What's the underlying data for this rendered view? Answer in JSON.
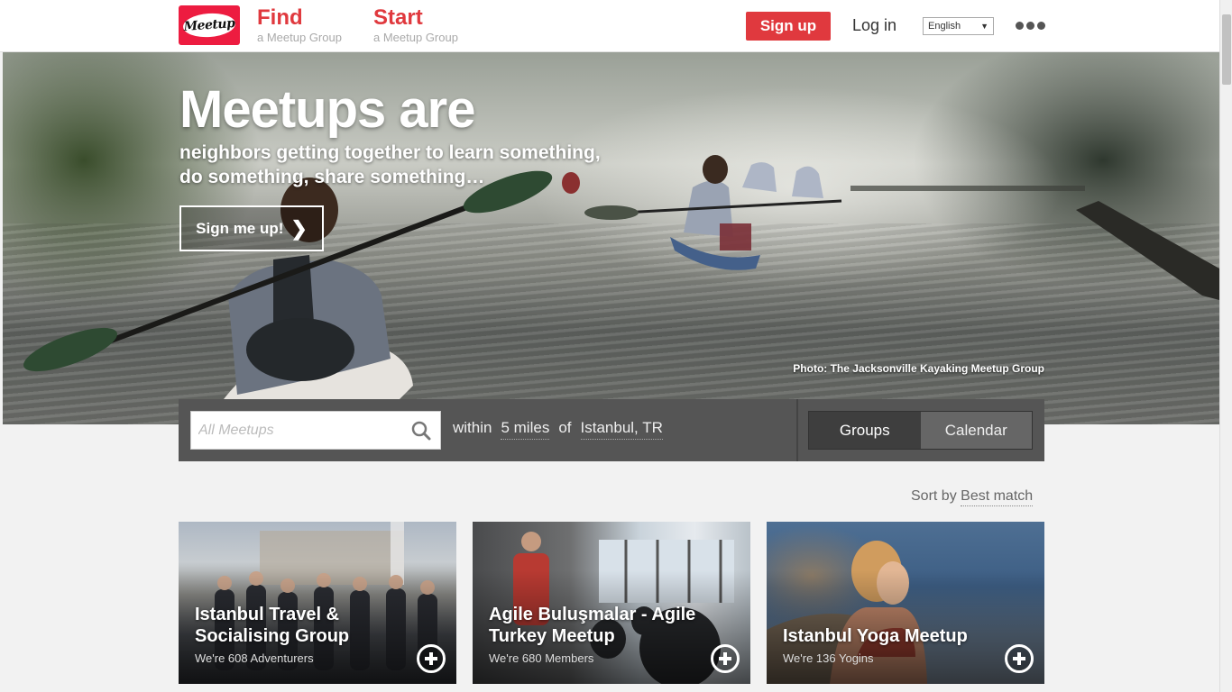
{
  "header": {
    "logo_text": "Meetup",
    "find": {
      "title": "Find",
      "subtitle": "a Meetup Group"
    },
    "start": {
      "title": "Start",
      "subtitle": "a Meetup Group"
    },
    "signup_label": "Sign up",
    "login_label": "Log in",
    "language": "English",
    "more_icon": "more-dots-icon"
  },
  "hero": {
    "title": "Meetups are",
    "subtitle_line1": "neighbors getting together to learn something,",
    "subtitle_line2": "do something, share something…",
    "cta_label": "Sign me up!",
    "photo_credit": "Photo: The Jacksonville Kayaking Meetup Group"
  },
  "search": {
    "placeholder": "All Meetups",
    "within_label": "within",
    "radius": "5 miles",
    "of_label": "of",
    "location": "Istanbul, TR",
    "view_groups": "Groups",
    "view_calendar": "Calendar"
  },
  "sort": {
    "label": "Sort by",
    "value": "Best match"
  },
  "groups": [
    {
      "title": "Istanbul Travel & Socialising Group",
      "meta": "We're 608 Adventurers"
    },
    {
      "title": "Agile Buluşmalar - Agile Turkey Meetup",
      "meta": "We're 680 Members"
    },
    {
      "title": "Istanbul Yoga Meetup",
      "meta": "We're 136 Yogins"
    }
  ],
  "colors": {
    "brand": "#e0393e",
    "searchbar": "#555555"
  }
}
